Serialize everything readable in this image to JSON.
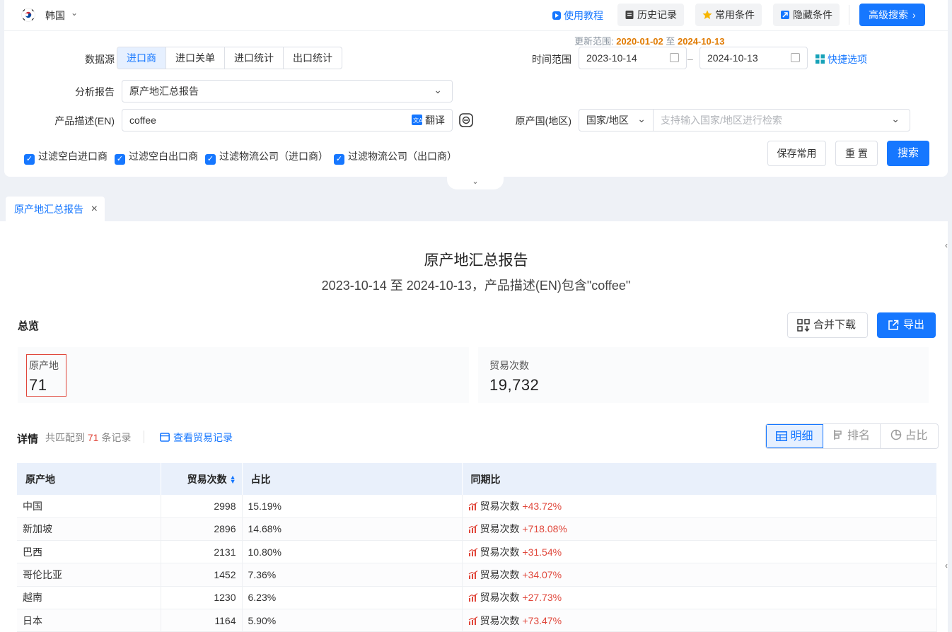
{
  "topbar": {
    "country": "韩国",
    "tutorial": "使用教程",
    "history": "历史记录",
    "common": "常用条件",
    "hide": "隐藏条件",
    "advanced": "高级搜索"
  },
  "update_range": {
    "label": "更新范围:",
    "start": "2020-01-02",
    "to": "至",
    "end": "2024-10-13"
  },
  "form": {
    "datasource_label": "数据源",
    "datasource_tabs": [
      "进口商",
      "进口关单",
      "进口统计",
      "出口统计"
    ],
    "datasource_selected": "进口商",
    "time_label": "时间范围",
    "date_start": "2023-10-14",
    "date_end": "2024-10-13",
    "quick_options": "快捷选项",
    "report_label": "分析报告",
    "report_value": "原产地汇总报告",
    "desc_label": "产品描述(EN)",
    "desc_value": "coffee",
    "translate": "翻译",
    "origin_label": "原产国(地区)",
    "origin_type": "国家/地区",
    "origin_placeholder": "支持输入国家/地区进行检索",
    "filters": [
      "过滤空白进口商",
      "过滤空白出口商",
      "过滤物流公司（进口商）",
      "过滤物流公司（出口商）"
    ],
    "save_common": "保存常用",
    "reset": "重 置",
    "search": "搜索"
  },
  "tab": {
    "label": "原产地汇总报告"
  },
  "report": {
    "title": "原产地汇总报告",
    "subtitle": "2023-10-14 至 2024-10-13，产品描述(EN)包含\"coffee\"",
    "overview_label": "总览",
    "merge_download": "合并下载",
    "export": "导出",
    "cards": [
      {
        "label": "原产地",
        "value": "71"
      },
      {
        "label": "贸易次数",
        "value": "19,732"
      }
    ],
    "detail_label": "详情",
    "match_prefix": "共匹配到",
    "match_count": "71",
    "match_suffix": "条记录",
    "view_trade": "查看贸易记录",
    "views": [
      "明细",
      "排名",
      "占比"
    ],
    "view_selected": "明细"
  },
  "table": {
    "columns": [
      "原产地",
      "贸易次数",
      "占比",
      "同期比"
    ],
    "rows": [
      {
        "origin": "中国",
        "count": "2998",
        "share": "15.19%",
        "yoy_label": "贸易次数",
        "yoy": "+43.72%"
      },
      {
        "origin": "新加坡",
        "count": "2896",
        "share": "14.68%",
        "yoy_label": "贸易次数",
        "yoy": "+718.08%"
      },
      {
        "origin": "巴西",
        "count": "2131",
        "share": "10.80%",
        "yoy_label": "贸易次数",
        "yoy": "+31.54%"
      },
      {
        "origin": "哥伦比亚",
        "count": "1452",
        "share": "7.36%",
        "yoy_label": "贸易次数",
        "yoy": "+34.07%"
      },
      {
        "origin": "越南",
        "count": "1230",
        "share": "6.23%",
        "yoy_label": "贸易次数",
        "yoy": "+27.73%"
      },
      {
        "origin": "日本",
        "count": "1164",
        "share": "5.90%",
        "yoy_label": "贸易次数",
        "yoy": "+73.47%"
      }
    ]
  },
  "colors": {
    "primary": "#1677ff",
    "accent_orange": "#e07a00",
    "positive_red": "#e0473b"
  }
}
